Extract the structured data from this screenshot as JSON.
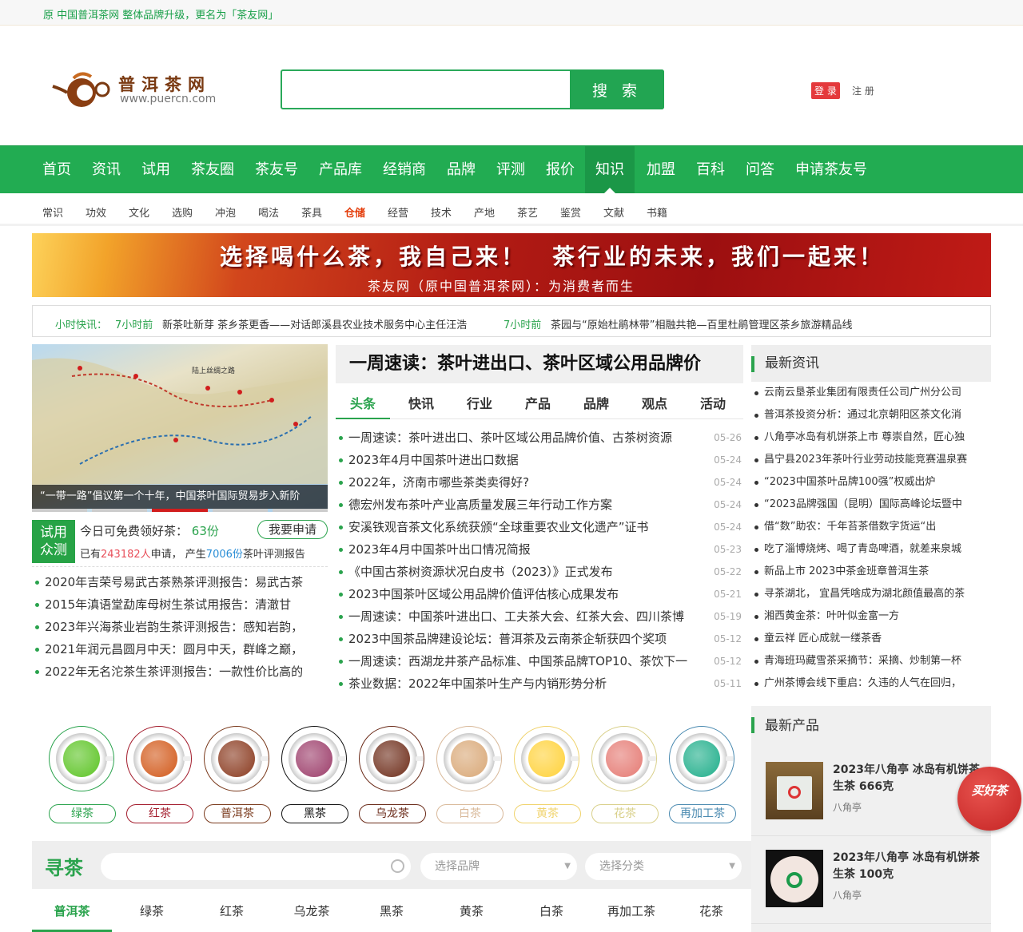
{
  "topbar": {
    "notice": "原 中国普洱茶网 整体品牌升级，更名为「茶友网」"
  },
  "logo": {
    "name": "普洱茶网",
    "url": "www.puercn.com"
  },
  "search": {
    "value": "",
    "button": "搜 索"
  },
  "account": {
    "login": "登 录",
    "register": "注 册"
  },
  "nav": {
    "items": [
      "首页",
      "资讯",
      "试用",
      "茶友圈",
      "茶友号",
      "产品库",
      "经销商",
      "品牌",
      "评测",
      "报价",
      "知识",
      "加盟",
      "百科",
      "问答",
      "申请茶友号"
    ],
    "active": "知识"
  },
  "subnav": {
    "items": [
      "常识",
      "功效",
      "文化",
      "选购",
      "冲泡",
      "喝法",
      "茶具",
      "仓储",
      "经营",
      "技术",
      "产地",
      "茶艺",
      "鉴赏",
      "文献",
      "书籍"
    ],
    "highlight": "仓储"
  },
  "banner": {
    "headline": "选择喝什么茶，我自己来！　茶行业的未来，我们一起来！",
    "sub": "茶友网（原中国普洱茶网）：为消费者而生"
  },
  "ticker": {
    "label": "小时快讯：",
    "items": [
      {
        "time": "7小时前",
        "title": "新茶吐新芽 茶乡茶更香——对话郎溪县农业技术服务中心主任汪浩"
      },
      {
        "time": "7小时前",
        "title": "茶园与“原始杜鹃林带”相融共艳—百里杜鹃管理区茶乡旅游精品线"
      }
    ]
  },
  "slider": {
    "caption": "“一带一路”倡议第一个十年，中国茶叶国际贸易步入新阶",
    "map_label": "陆上丝绸之路",
    "active_index": 3,
    "count": 5
  },
  "trial": {
    "badge": [
      "试用",
      "众测"
    ],
    "today_label": "今日可免费领好茶：",
    "today_count": "63份",
    "apply": "我要申请",
    "p1": "已有",
    "applicants": "243182人",
    "p2": "申请，  产生",
    "reports": "7006份",
    "p3": "茶叶评测报告"
  },
  "reports": [
    "2020年吉荣号易武古茶熟茶评测报告：易武古茶",
    "2015年滇语堂勐库母树生茶试用报告：清澈甘",
    "2023年兴海茶业岩韵生茶评测报告：感知岩韵，",
    "2021年润元昌圆月中天：圆月中天，群峰之巅，",
    "2022年无名沱茶生茶评测报告：一款性价比高的"
  ],
  "headline": "一周速读：茶叶进出口、茶叶区域公用品牌价",
  "tabs": [
    "头条",
    "快讯",
    "行业",
    "产品",
    "品牌",
    "观点",
    "活动"
  ],
  "news": [
    {
      "t": "一周速读：茶叶进出口、茶叶区域公用品牌价值、古茶树资源",
      "d": "05-26"
    },
    {
      "t": "2023年4月中国茶叶进出口数据",
      "d": "05-24"
    },
    {
      "t": "2022年，济南市哪些茶类卖得好?",
      "d": "05-24"
    },
    {
      "t": "德宏州发布茶叶产业高质量发展三年行动工作方案",
      "d": "05-24"
    },
    {
      "t": "安溪铁观音茶文化系统获颁“全球重要农业文化遗产”证书",
      "d": "05-24"
    },
    {
      "t": "2023年4月中国茶叶出口情况简报",
      "d": "05-23"
    },
    {
      "t": "《中国古茶树资源状况白皮书（2023）》正式发布",
      "d": "05-22"
    },
    {
      "t": "2023中国茶叶区域公用品牌价值评估核心成果发布",
      "d": "05-21"
    },
    {
      "t": "一周速读：中国茶叶进出口、工夫茶大会、红茶大会、四川茶博",
      "d": "05-19"
    },
    {
      "t": "2023中国茶品牌建设论坛：普洱茶及云南茶企斩获四个奖项",
      "d": "05-12"
    },
    {
      "t": "一周速读：西湖龙井茶产品标准、中国茶品牌TOP10、茶饮下一",
      "d": "05-12"
    },
    {
      "t": "茶业数据：2022年中国茶叶生产与内销形势分析",
      "d": "05-11"
    }
  ],
  "latest": {
    "title": "最新资讯",
    "items": [
      "云南云垦茶业集团有限责任公司广州分公司",
      "普洱茶投资分析：通过北京朝阳区茶文化消",
      "八角亭冰岛有机饼茶上市 尊崇自然，匠心独",
      "昌宁县2023年茶叶行业劳动技能竞赛温泉赛",
      "“2023中国茶叶品牌100强”权威出炉",
      "“2023品牌强国（昆明）国际高峰论坛暨中",
      "借“数”助农：千年苔茶借数字货运“出",
      "吃了淄博烧烤、喝了青岛啤酒，就差来泉城",
      "新品上市 2023中茶金班章普洱生茶",
      "寻茶湖北， 宜昌凭啥成为湖北颜值最高的茶",
      "湘西黄金茶：叶叶似金富一方",
      "童云祥 匠心成就一缕茶香",
      "青海班玛藏雪茶采摘节：采摘、炒制第一杯",
      "广州茶博会线下重启：久违的人气在回归，"
    ]
  },
  "products": {
    "title": "最新产品",
    "items": [
      {
        "name": "2023年八角亭 冰岛有机饼茶 生茶 666克",
        "brand": "八角亭"
      },
      {
        "name": "2023年八角亭 冰岛有机饼茶 生茶 100克",
        "brand": "八角亭"
      }
    ],
    "buy": "买好茶"
  },
  "teas": [
    {
      "name": "绿茶",
      "color": "#5cc424",
      "border": "#2aa34d"
    },
    {
      "name": "红茶",
      "color": "#d2591a",
      "border": "#a31c2c"
    },
    {
      "name": "普洱茶",
      "color": "#8a3a1f",
      "border": "#7a3a1c"
    },
    {
      "name": "黑茶",
      "color": "#9c3d6a",
      "border": "#111111"
    },
    {
      "name": "乌龙茶",
      "color": "#6e2d1a",
      "border": "#6a2a18"
    },
    {
      "name": "白茶",
      "color": "#d9a877",
      "border": "#d9b99a"
    },
    {
      "name": "黄茶",
      "color": "#ffd23a",
      "border": "#f0d36c"
    },
    {
      "name": "花茶",
      "color": "#e57a73",
      "border": "#d9d08a"
    },
    {
      "name": "再加工茶",
      "color": "#1fae8a",
      "border": "#4a8ab0"
    }
  ],
  "finder": {
    "title": "寻茶",
    "brand": "选择品牌",
    "category": "选择分类",
    "tabs": [
      "普洱茶",
      "绿茶",
      "红茶",
      "乌龙茶",
      "黑茶",
      "黄茶",
      "白茶",
      "再加工茶",
      "花茶"
    ]
  }
}
